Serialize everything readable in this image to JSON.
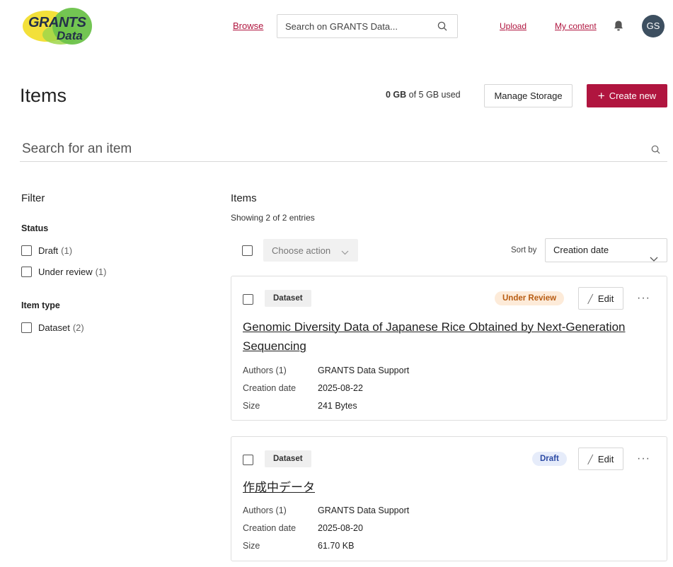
{
  "header": {
    "logo_line1": "GRANTS",
    "logo_line2": "Data",
    "browse": "Browse",
    "search_placeholder": "Search on GRANTS Data...",
    "upload": "Upload",
    "my_content": "My content",
    "avatar_initials": "GS"
  },
  "page": {
    "title": "Items",
    "storage_used": "0 GB",
    "storage_rest": " of 5 GB used",
    "manage_storage": "Manage Storage",
    "create_new": "Create new",
    "item_search_placeholder": "Search for an item"
  },
  "filter": {
    "title": "Filter",
    "status_title": "Status",
    "status_options": [
      {
        "label": "Draft",
        "count": "(1)"
      },
      {
        "label": "Under review",
        "count": "(1)"
      }
    ],
    "type_title": "Item type",
    "type_options": [
      {
        "label": "Dataset",
        "count": "(2)"
      }
    ]
  },
  "list": {
    "title": "Items",
    "showing": "Showing 2 of 2 entries",
    "choose_action": "Choose action",
    "sort_by_label": "Sort by",
    "sort_value": "Creation date",
    "edit_label": "Edit",
    "more_label": "···",
    "items": [
      {
        "type": "Dataset",
        "status": "Under Review",
        "title": "Genomic Diversity Data of Japanese Rice Obtained by Next-Generation Sequencing",
        "authors_label": "Authors (1)",
        "authors": "GRANTS Data Support",
        "date_label": "Creation date",
        "date": "2025-08-22",
        "size_label": "Size",
        "size": "241 Bytes"
      },
      {
        "type": "Dataset",
        "status": "Draft",
        "title": "作成中データ",
        "authors_label": "Authors (1)",
        "authors": "GRANTS Data Support",
        "date_label": "Creation date",
        "date": "2025-08-20",
        "size_label": "Size",
        "size": "61.70 KB"
      }
    ]
  },
  "colors": {
    "brand": "#b0153f",
    "review_bg": "#fdebd9",
    "review_fg": "#b85c12",
    "draft_bg": "#e6ecfa",
    "draft_fg": "#2c4aa4",
    "avatar_bg": "#3d4f60"
  },
  "icons": [
    "search-icon",
    "bell-icon",
    "plus-icon",
    "chevron-down-icon",
    "pencil-icon",
    "more-icon"
  ]
}
